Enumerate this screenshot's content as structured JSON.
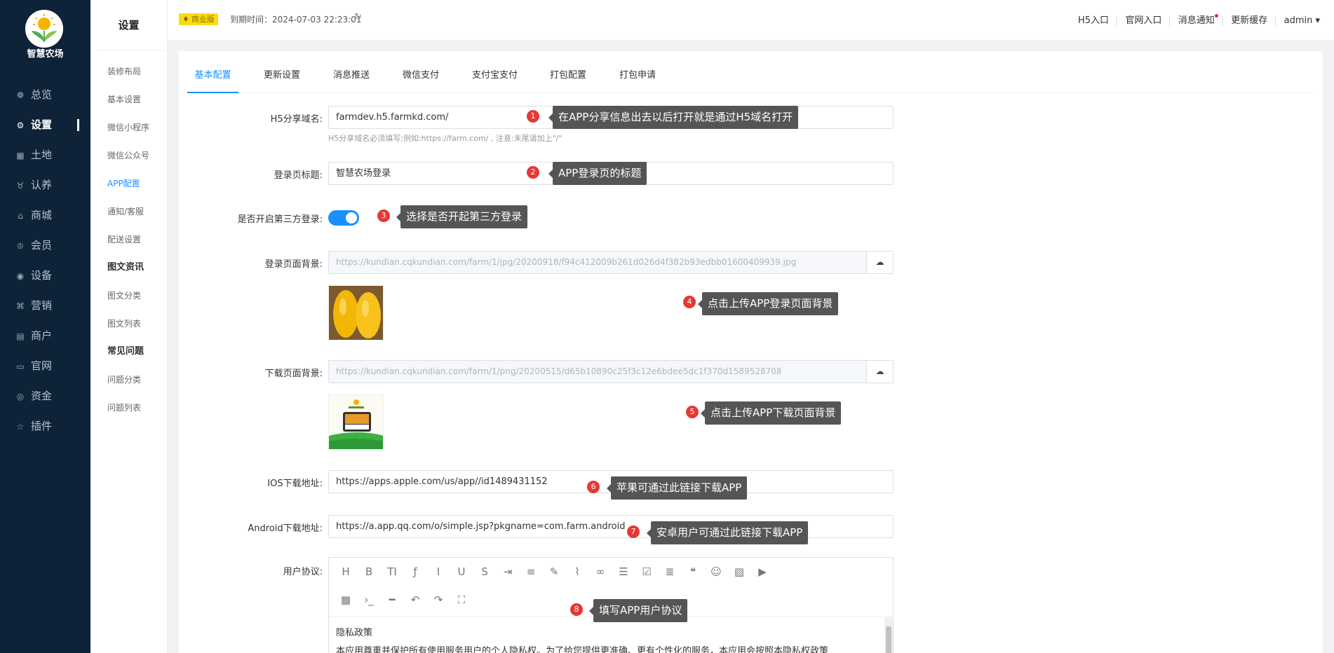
{
  "brand": {
    "name": "智慧农场"
  },
  "nav": [
    {
      "label": "总览",
      "icon": "dashboard-icon",
      "glyph": "❁",
      "active": false
    },
    {
      "label": "设置",
      "icon": "gear-icon",
      "glyph": "⚙",
      "active": true
    },
    {
      "label": "土地",
      "icon": "grid-icon",
      "glyph": "▦",
      "active": false
    },
    {
      "label": "认养",
      "icon": "cow-icon",
      "glyph": "♉",
      "active": false
    },
    {
      "label": "商城",
      "icon": "shop-icon",
      "glyph": "⌂",
      "active": false
    },
    {
      "label": "会员",
      "icon": "crown-icon",
      "glyph": "♔",
      "active": false
    },
    {
      "label": "设备",
      "icon": "location-icon",
      "glyph": "◉",
      "active": false
    },
    {
      "label": "营销",
      "icon": "command-icon",
      "glyph": "⌘",
      "active": false
    },
    {
      "label": "商户",
      "icon": "store-icon",
      "glyph": "▤",
      "active": false
    },
    {
      "label": "官网",
      "icon": "browser-icon",
      "glyph": "▭",
      "active": false
    },
    {
      "label": "资金",
      "icon": "money-icon",
      "glyph": "◎",
      "active": false
    },
    {
      "label": "插件",
      "icon": "star-icon",
      "glyph": "☆",
      "active": false
    }
  ],
  "subnav": {
    "title": "设置",
    "items": [
      {
        "label": "装修布局",
        "type": "item"
      },
      {
        "label": "基本设置",
        "type": "item"
      },
      {
        "label": "微信小程序",
        "type": "item"
      },
      {
        "label": "微信公众号",
        "type": "item"
      },
      {
        "label": "APP配置",
        "type": "active"
      },
      {
        "label": "通知/客服",
        "type": "item"
      },
      {
        "label": "配送设置",
        "type": "item"
      },
      {
        "label": "图文资讯",
        "type": "group"
      },
      {
        "label": "图文分类",
        "type": "item"
      },
      {
        "label": "图文列表",
        "type": "item"
      },
      {
        "label": "常见问题",
        "type": "group"
      },
      {
        "label": "问题分类",
        "type": "item"
      },
      {
        "label": "问题列表",
        "type": "item"
      }
    ]
  },
  "topbar": {
    "badge": "商业版",
    "expire": "到期时间：2024-07-03 22:23:01",
    "links": [
      "H5入口",
      "官网入口",
      "消息通知",
      "更新缓存",
      "admin ▾"
    ]
  },
  "tabs": [
    "基本配置",
    "更新设置",
    "消息推送",
    "微信支付",
    "支付宝支付",
    "打包配置",
    "打包申请"
  ],
  "form": {
    "h5_label": "H5分享域名:",
    "h5_value": "farmdev.h5.farmkd.com/",
    "h5_hint": "H5分享域名必须填写;例如:https://farm.com/ , 注意:末尾请加上\"/\"",
    "login_title_label": "登录页标题:",
    "login_title_value": "智慧农场登录",
    "third_login_label": "是否开启第三方登录:",
    "third_login_on": true,
    "login_bg_label": "登录页面背景:",
    "login_bg_value": "https://kundian.cqkundian.com/farm/1/jpg/20200918/f94c412009b261d026d4f382b93edbb01600409939.jpg",
    "download_bg_label": "下载页面背景:",
    "download_bg_value": "https://kundian.cqkundian.com/farm/1/png/20200515/d65b10890c25f3c12e6bdee5dc1f370d1589528708",
    "ios_label": "IOS下载地址:",
    "ios_value": "https://apps.apple.com/us/app//id1489431152",
    "android_label": "Android下载地址:",
    "android_value": "https://a.app.qq.com/o/simple.jsp?pkgname=com.farm.android",
    "agreement_label": "用户协议:",
    "agreement_line1": "隐私政策",
    "agreement_line2": "本应用尊重并保护所有使用服务用户的个人隐私权。为了给您提供更准确、更有个性化的服务，本应用会按照本隐私权政策"
  },
  "callouts": [
    {
      "n": "1",
      "text": "在APP分享信息出去以后打开就是通过H5域名打开"
    },
    {
      "n": "2",
      "text": "APP登录页的标题"
    },
    {
      "n": "3",
      "text": "选择是否开起第三方登录"
    },
    {
      "n": "4",
      "text": "点击上传APP登录页面背景"
    },
    {
      "n": "5",
      "text": "点击上传APP下载页面背景"
    },
    {
      "n": "6",
      "text": "苹果可通过此链接下载APP"
    },
    {
      "n": "7",
      "text": "安卓用户可通过此链接下载APP"
    },
    {
      "n": "8",
      "text": "填写APP用户协议"
    }
  ],
  "editor_tools": [
    {
      "icon": "heading-icon",
      "glyph": "H"
    },
    {
      "icon": "bold-icon",
      "glyph": "B"
    },
    {
      "icon": "font-size-icon",
      "glyph": "TI"
    },
    {
      "icon": "font-icon",
      "glyph": "ƒ"
    },
    {
      "icon": "italic-icon",
      "glyph": "I"
    },
    {
      "icon": "underline-icon",
      "glyph": "U"
    },
    {
      "icon": "strikethrough-icon",
      "glyph": "S"
    },
    {
      "icon": "indent-icon",
      "glyph": "⇥"
    },
    {
      "icon": "line-height-icon",
      "glyph": "≡"
    },
    {
      "icon": "pencil-icon",
      "glyph": "✎"
    },
    {
      "icon": "brush-icon",
      "glyph": "⌇"
    },
    {
      "icon": "link-icon",
      "glyph": "∞"
    },
    {
      "icon": "list-icon",
      "glyph": "☰"
    },
    {
      "icon": "checkbox-icon",
      "glyph": "☑"
    },
    {
      "icon": "align-icon",
      "glyph": "≣"
    },
    {
      "icon": "quote-icon",
      "glyph": "❝"
    },
    {
      "icon": "emoji-icon",
      "glyph": "☺"
    },
    {
      "icon": "image-icon",
      "glyph": "▨"
    },
    {
      "icon": "video-icon",
      "glyph": "▶"
    },
    {
      "icon": "table-icon",
      "glyph": "▦"
    },
    {
      "icon": "code-icon",
      "glyph": "›_"
    },
    {
      "icon": "divider-icon",
      "glyph": "━"
    },
    {
      "icon": "undo-icon",
      "glyph": "↶"
    },
    {
      "icon": "redo-icon",
      "glyph": "↷"
    },
    {
      "icon": "fullscreen-icon",
      "glyph": "⛶"
    }
  ]
}
